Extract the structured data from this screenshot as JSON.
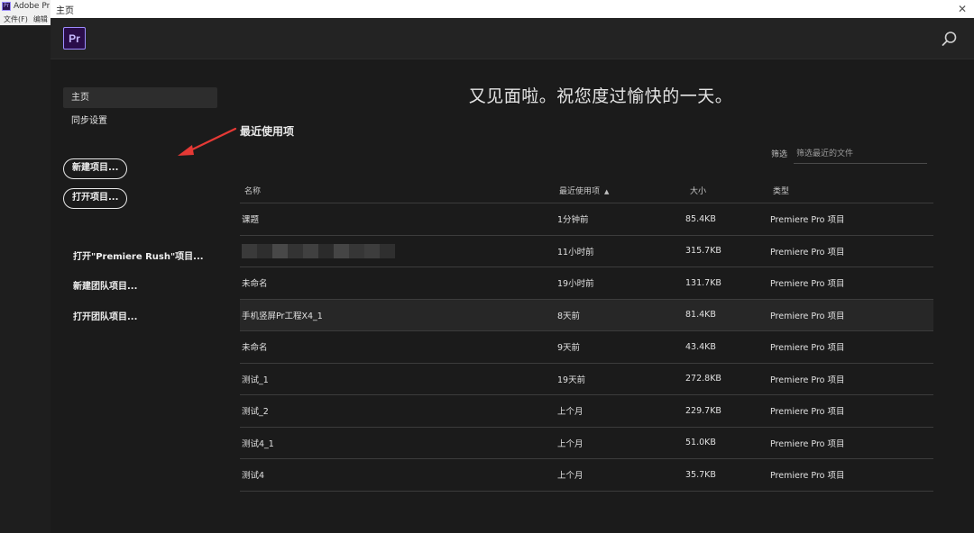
{
  "background_app": {
    "title": "Adobe Pr",
    "menu": [
      "文件(F)",
      "编辑"
    ]
  },
  "window": {
    "title": "主页",
    "close_glyph": "✕"
  },
  "header": {
    "logo_text": "Pr",
    "search_icon": "search-icon"
  },
  "sidebar": {
    "nav": [
      {
        "label": "主页",
        "active": true
      },
      {
        "label": "同步设置",
        "active": false
      }
    ],
    "new_project_label": "新建项目...",
    "open_project_label": "打开项目...",
    "open_rush_label": "打开\"Premiere Rush\"项目...",
    "new_team_label": "新建团队项目...",
    "open_team_label": "打开团队项目..."
  },
  "main": {
    "greeting": "又见面啦。祝您度过愉快的一天。",
    "recent_title": "最近使用项",
    "filter_label": "筛选",
    "filter_placeholder": "筛选最近的文件",
    "columns": {
      "name": "名称",
      "date": "最近使用项",
      "size": "大小",
      "type": "类型"
    },
    "rows": [
      {
        "name": "课题",
        "date": "1分钟前",
        "size": "85.4KB",
        "type": "Premiere Pro 项目"
      },
      {
        "name": "",
        "date": "11小时前",
        "size": "315.7KB",
        "type": "Premiere Pro 项目"
      },
      {
        "name": "未命名",
        "date": "19小时前",
        "size": "131.7KB",
        "type": "Premiere Pro 项目"
      },
      {
        "name": "手机竖屏Pr工程X4_1",
        "date": "8天前",
        "size": "81.4KB",
        "type": "Premiere Pro 项目"
      },
      {
        "name": "未命名",
        "date": "9天前",
        "size": "43.4KB",
        "type": "Premiere Pro 项目"
      },
      {
        "name": "测试_1",
        "date": "19天前",
        "size": "272.8KB",
        "type": "Premiere Pro 项目"
      },
      {
        "name": "测试_2",
        "date": "上个月",
        "size": "229.7KB",
        "type": "Premiere Pro 项目"
      },
      {
        "name": "测试4_1",
        "date": "上个月",
        "size": "51.0KB",
        "type": "Premiere Pro 项目"
      },
      {
        "name": "测试4",
        "date": "上个月",
        "size": "35.7KB",
        "type": "Premiere Pro 项目"
      }
    ]
  },
  "colors": {
    "background": "#1b1b1b",
    "header": "#232323",
    "selected_row": "#272727",
    "accent_logo_border": "#9d8cff",
    "annotation_arrow": "#e53935"
  }
}
